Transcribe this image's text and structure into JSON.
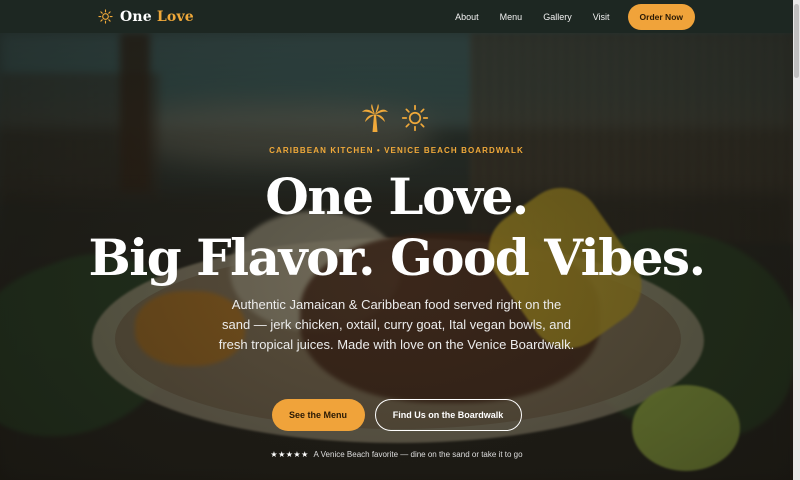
{
  "brand": {
    "name_part1": "One",
    "name_part2": "Love",
    "logo_icon": "sun-icon"
  },
  "nav": {
    "links": [
      "About",
      "Menu",
      "Gallery",
      "Visit"
    ],
    "cta": "Order Now"
  },
  "hero": {
    "icons": [
      "palm-tree-icon",
      "sun-icon"
    ],
    "eyebrow": "CARIBBEAN KITCHEN • VENICE BEACH BOARDWALK",
    "headline_line1": "One Love.",
    "headline_line2": "Big Flavor. Good Vibes.",
    "description": "Authentic Jamaican & Caribbean food served right on the sand — jerk chicken, oxtail, curry goat, Ital vegan bowls, and fresh tropical juices. Made with love on the Venice Boardwalk.",
    "primary_button": "See the Menu",
    "secondary_button": "Find Us on the Boardwalk",
    "rating_stars": "★★★★★",
    "tagline": "A Venice Beach favorite — dine on the sand or take it to go"
  },
  "colors": {
    "accent": "#f0a33a",
    "nav_background": "#1d2722",
    "text": "#ffffff"
  }
}
